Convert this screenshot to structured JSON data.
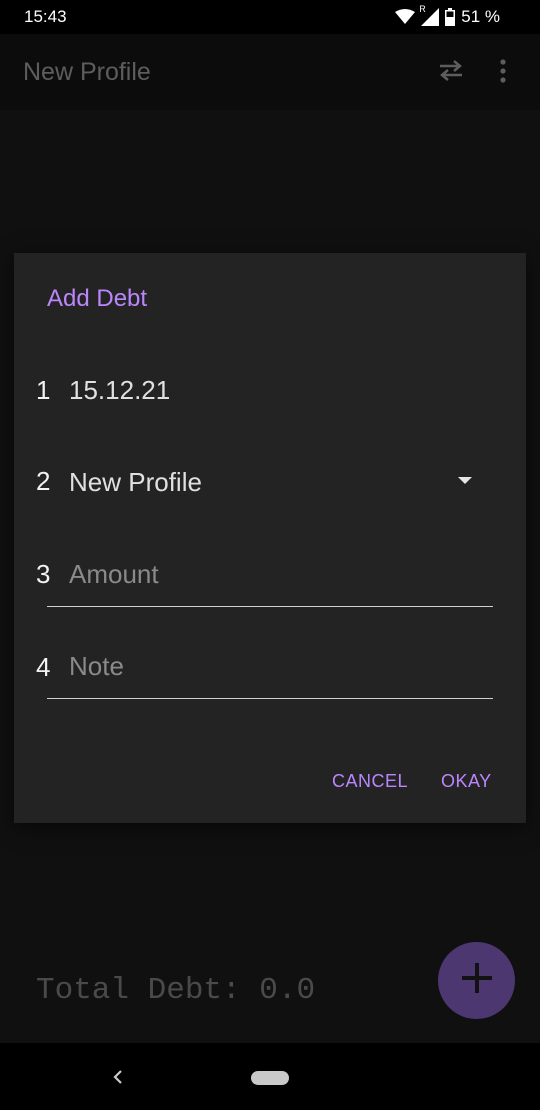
{
  "status_bar": {
    "time": "15:43",
    "battery_percent": "51 %",
    "network_indicator": "R"
  },
  "app_bar": {
    "title": "New Profile",
    "icons": [
      "swap-icon",
      "more-vert-icon"
    ]
  },
  "dialog": {
    "title": "Add Debt",
    "fields": [
      {
        "number": "1",
        "value": "15.12.21",
        "placeholder": ""
      },
      {
        "number": "2",
        "value": "New Profile",
        "placeholder": ""
      },
      {
        "number": "3",
        "value": "",
        "placeholder": "Amount"
      },
      {
        "number": "4",
        "value": "",
        "placeholder": "Note"
      }
    ],
    "cancel_label": "CANCEL",
    "okay_label": "OKAY"
  },
  "summary": {
    "total_debt": "Total Debt: 0.0"
  },
  "colors": {
    "accent": "#bb86fc",
    "fab": "#4d3770",
    "dialog_bg": "#232323"
  }
}
